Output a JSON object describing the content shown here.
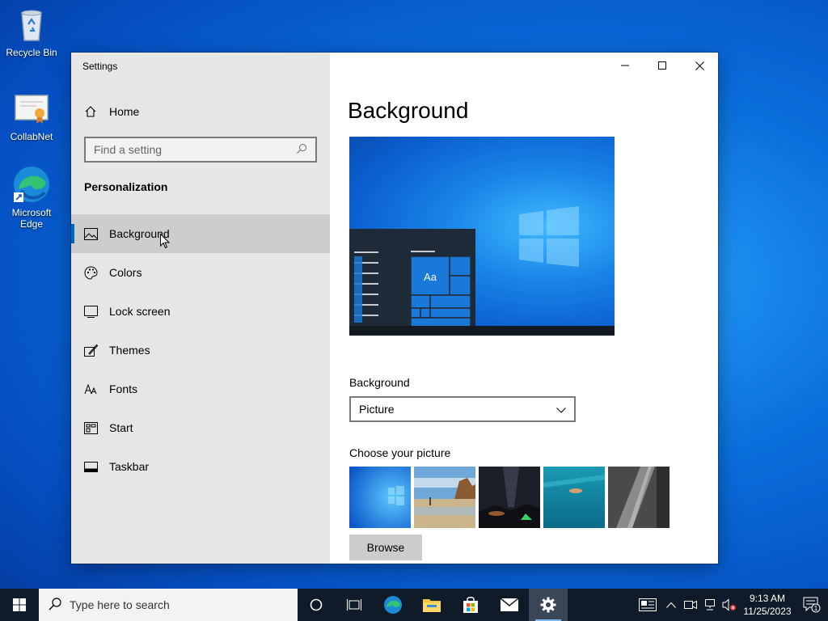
{
  "desktop": {
    "icons": [
      {
        "label": "Recycle Bin"
      },
      {
        "label": "CollabNet"
      },
      {
        "label": "Microsoft Edge"
      }
    ]
  },
  "window": {
    "app_title": "Settings",
    "sidebar": {
      "home_label": "Home",
      "search_placeholder": "Find a setting",
      "section_title": "Personalization",
      "items": [
        {
          "label": "Background",
          "icon": "picture-icon",
          "selected": true
        },
        {
          "label": "Colors",
          "icon": "palette-icon"
        },
        {
          "label": "Lock screen",
          "icon": "lock-screen-icon"
        },
        {
          "label": "Themes",
          "icon": "themes-icon"
        },
        {
          "label": "Fonts",
          "icon": "fonts-icon"
        },
        {
          "label": "Start",
          "icon": "start-icon"
        },
        {
          "label": "Taskbar",
          "icon": "taskbar-icon"
        }
      ]
    },
    "content": {
      "page_title": "Background",
      "preview_tile_text": "Aa",
      "background_label": "Background",
      "background_value": "Picture",
      "choose_picture_label": "Choose your picture",
      "browse_label": "Browse"
    }
  },
  "taskbar": {
    "search_placeholder": "Type here to search",
    "clock_time": "9:13 AM",
    "clock_date": "11/25/2023",
    "notification_count": "1",
    "accent": "#0067c0"
  }
}
